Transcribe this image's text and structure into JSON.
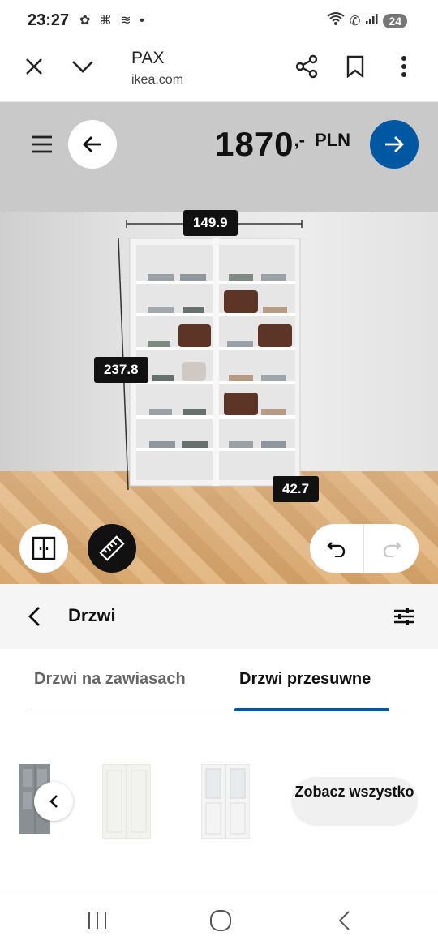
{
  "status": {
    "time": "23:27",
    "battery": "24"
  },
  "browser": {
    "title": "PAX",
    "url": "ikea.com"
  },
  "scene": {
    "price_value": "1870",
    "price_suffix": ",-",
    "price_currency": "PLN",
    "dim_width": "149.9",
    "dim_height": "237.8",
    "dim_depth": "42.7"
  },
  "panel": {
    "title": "Drzwi",
    "tabs": [
      {
        "label": "Drzwi na zawiasach",
        "active": false
      },
      {
        "label": "Drzwi przesuwne",
        "active": true
      }
    ],
    "see_all": "Zobacz wszystko"
  },
  "colors": {
    "accent": "#0058a3",
    "panel_bg": "#f5f5f5"
  },
  "icons": [
    "close-icon",
    "chevron-down-icon",
    "share-icon",
    "bookmark-icon",
    "more-vert-icon",
    "menu-icon",
    "arrow-left-icon",
    "arrow-right-icon",
    "door-icon",
    "ruler-icon",
    "undo-icon",
    "redo-icon",
    "back-chevron-icon",
    "filter-icon",
    "chevron-left-icon",
    "recents-icon",
    "home-icon",
    "back-icon"
  ]
}
